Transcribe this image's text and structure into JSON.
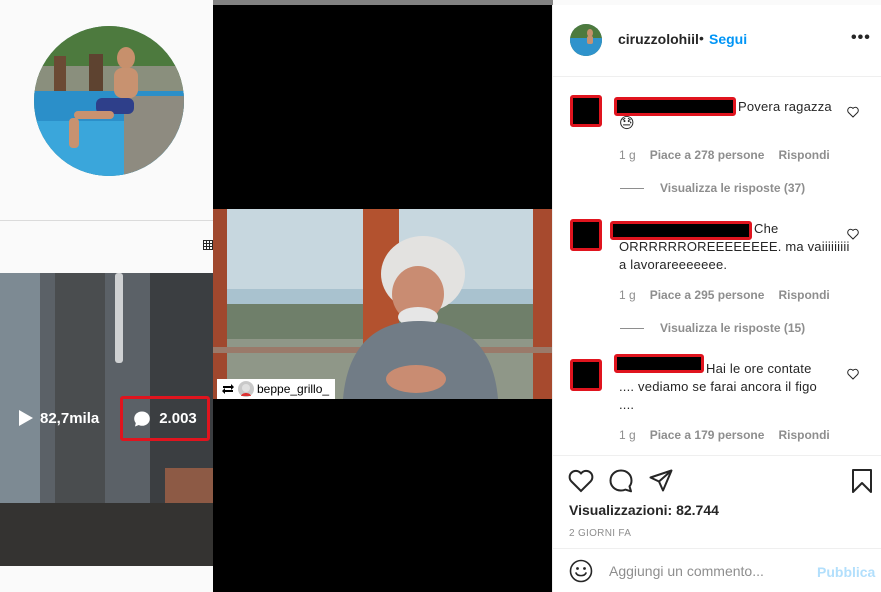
{
  "profile_grid": {
    "views_count": "82,7mila",
    "comments_count": "2.003"
  },
  "media": {
    "repost_username": "beppe_grillo_"
  },
  "post_header": {
    "username": "ciruzzolohiil",
    "separator": "•",
    "follow_label": "Segui",
    "more_label": "•••"
  },
  "comments": [
    {
      "text": "Povera ragazza",
      "emoji": "😓",
      "time": "1 g",
      "likes": "Piace a 278 persone",
      "reply_label": "Rispondi",
      "view_replies": "Visualizza le risposte (37)"
    },
    {
      "text_line1": "Che",
      "text_line2": "ORRRRRROREEEEEEEE. ma vaiiiiiiiii",
      "text_line3": "a lavorareeeeeee.",
      "time": "1 g",
      "likes": "Piace a 295 persone",
      "reply_label": "Rispondi",
      "view_replies": "Visualizza le risposte (15)"
    },
    {
      "text_line1": "Hai le ore contate",
      "text_line2": ".... vediamo se farai ancora il figo",
      "text_line3": "....",
      "time": "1 g",
      "likes": "Piace a 179 persone",
      "reply_label": "Rispondi"
    }
  ],
  "post_footer": {
    "views": "Visualizzazioni: 82.744",
    "date": "2 GIORNI FA"
  },
  "add_comment": {
    "placeholder": "Aggiungi un commento...",
    "publish_label": "Pubblica"
  },
  "colors": {
    "accent": "#0095f6",
    "highlight_border": "#e0141e",
    "publish_disabled": "#b2dffc"
  }
}
